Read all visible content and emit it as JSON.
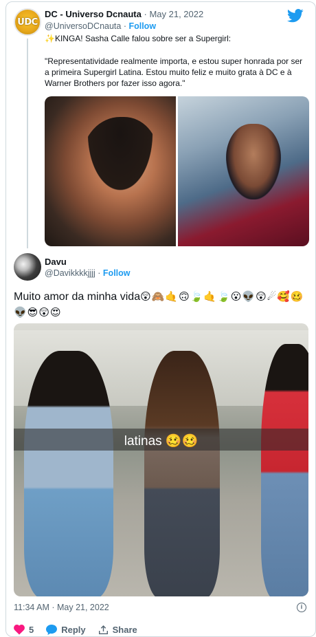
{
  "quoted_tweet": {
    "author_name": "DC - Universo Dcnauta",
    "date": "May 21, 2022",
    "handle": "@UniversoDCnauta",
    "follow_label": "Follow",
    "avatar_text": "UDC",
    "sparkles": "✨",
    "line1": "KINGA! Sasha Calle falou sobre ser a Supergirl:",
    "quote": "\"Representatividade realmente importa, e estou super honrada por ser a primeira Supergirl Latina. Estou muito feliz e muito grata à DC e à Warner Brothers por fazer isso agora.\""
  },
  "tweet": {
    "author_name": "Davu",
    "handle": "@Davikkkkjjjj",
    "follow_label": "Follow",
    "text": "Muito amor da minha vida",
    "emojis": "😲🙈🤙🙃🍃🤙🍃😮👽😲☄🥰🥴👽😎😲😍",
    "image_caption": "latinas 🥴🥴",
    "timestamp": "11:34 AM · May 21, 2022",
    "likes": "5",
    "reply_label": "Reply",
    "share_label": "Share",
    "info_glyph": "i"
  },
  "colors": {
    "accent": "#1d9bf0",
    "like": "#f91880",
    "text_secondary": "#536471"
  },
  "icons": [
    "twitter-bird-icon",
    "info-icon",
    "heart-icon",
    "reply-icon",
    "share-icon"
  ]
}
